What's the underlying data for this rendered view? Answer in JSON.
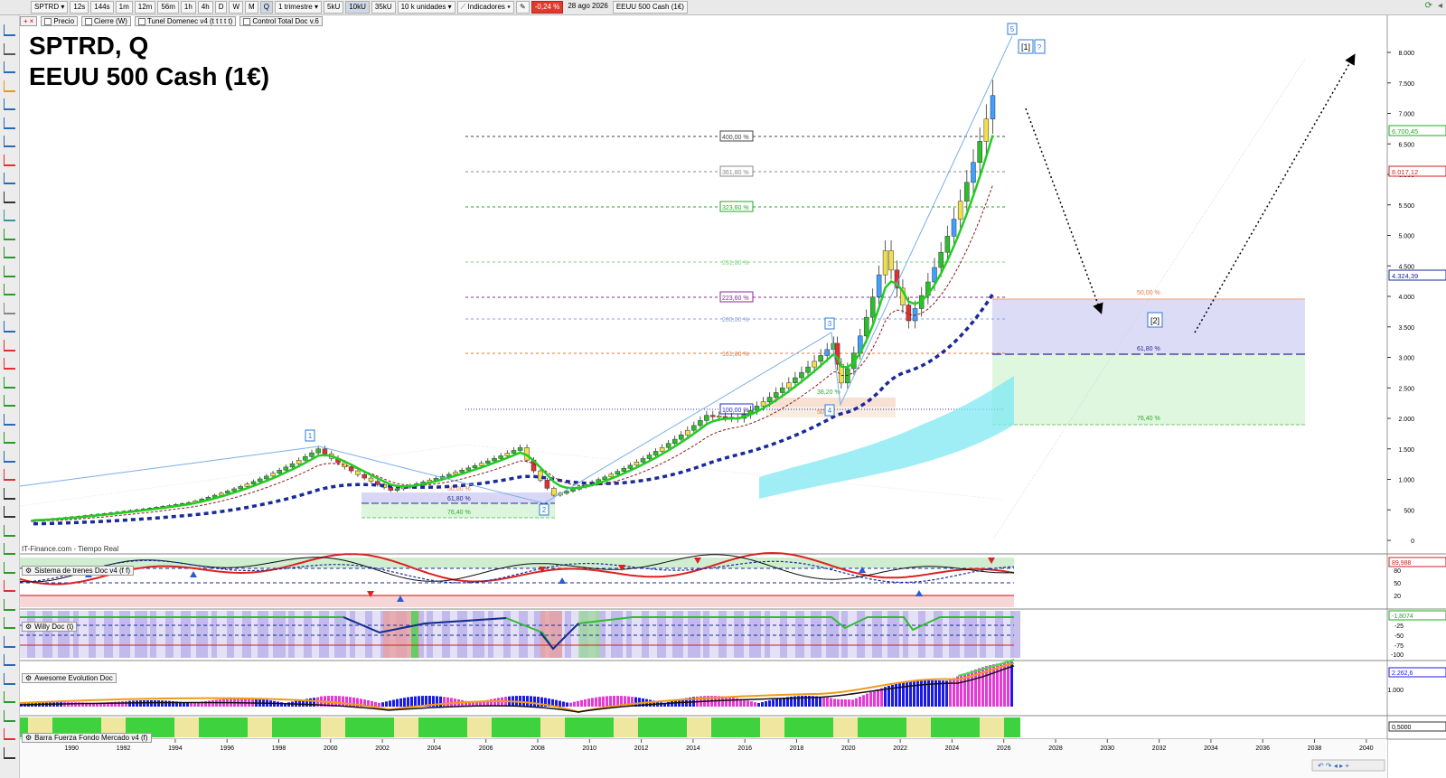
{
  "toolbar": {
    "symbol": "SPTRD",
    "timeframes": [
      "12s",
      "144s",
      "1m",
      "12m",
      "56m",
      "1h",
      "4h",
      "D",
      "W",
      "M",
      "Q"
    ],
    "period": "1 trimestre",
    "units": [
      "5kU",
      "10kU",
      "35kU"
    ],
    "units_dropdown": "10 k unidades",
    "indicators_label": "Indicadores",
    "change": "-0,24 %",
    "date": "28 ago 2026",
    "instrument": "EEUU 500 Cash (1€)"
  },
  "layers": [
    "Precio",
    "Cierre (W)",
    "Tunel Domenec v4 (t t t t t)",
    "Control Total Doc v.6"
  ],
  "title": {
    "line1": "SPTRD, Q",
    "line2": "EEUU 500 Cash (1€)"
  },
  "watermark": "IT-Finance.com - Tiempo Real",
  "price_axis": {
    "ticks": [
      "8.000",
      "7.500",
      "7.000",
      "6.500",
      "6.000",
      "5.500",
      "5.000",
      "4.500",
      "4.000",
      "3.500",
      "3.000",
      "2.500",
      "2.000",
      "1.500",
      "1.000",
      "500",
      "0"
    ],
    "tags": [
      {
        "text": "6.700,45",
        "color": "#22aa22"
      },
      {
        "text": "6.017,12",
        "color": "#cc2222"
      },
      {
        "text": "4.324,39",
        "color": "#1a2a99"
      }
    ]
  },
  "fib_levels": [
    "400,00 %",
    "361,80 %",
    "323,60 %",
    "261,80 %",
    "223,60 %",
    "200,00 %",
    "161,80 %",
    "100,00 %"
  ],
  "zone_labels": [
    "50,00 %",
    "61,80 %",
    "76,40 %"
  ],
  "small_zone_labels": [
    "50,00 %",
    "61,80 %",
    "76,40 %"
  ],
  "wave_labels": [
    "1",
    "2",
    "3",
    "4",
    "5",
    "[1]",
    "?",
    "[2]"
  ],
  "mini_labels": [
    "38,20 %",
    "50"
  ],
  "indicators": [
    {
      "name": "Sistema de trenes Doc v4 (f f)",
      "ticks": [
        "80",
        "50",
        "20"
      ],
      "tag": "89,988"
    },
    {
      "name": "Willy Doc (t)",
      "ticks": [
        "-25",
        "-50",
        "-75",
        "-100"
      ],
      "tag": "-1,8074"
    },
    {
      "name": "Awesome Evolution Doc",
      "ticks": [
        "1.000"
      ],
      "tag": "2.262,6"
    },
    {
      "name": "Barra Fuerza Fondo Mercado v4 (f)",
      "ticks": [],
      "tag": "0,5000"
    }
  ],
  "time_axis": [
    "1990",
    "1992",
    "1994",
    "1996",
    "1998",
    "2000",
    "2002",
    "2004",
    "2006",
    "2008",
    "2010",
    "2012",
    "2014",
    "2016",
    "2018",
    "2020",
    "2022",
    "2024",
    "2026",
    "2028",
    "2030",
    "2032",
    "2034",
    "2036",
    "2038",
    "2040"
  ],
  "colors": {
    "green": "#22cc22",
    "red": "#dd2222",
    "navy": "#1a2a99",
    "zone_blue": "#d8d8f6",
    "zone_green": "#dcf5dc",
    "cyan": "#7fe8f2"
  }
}
